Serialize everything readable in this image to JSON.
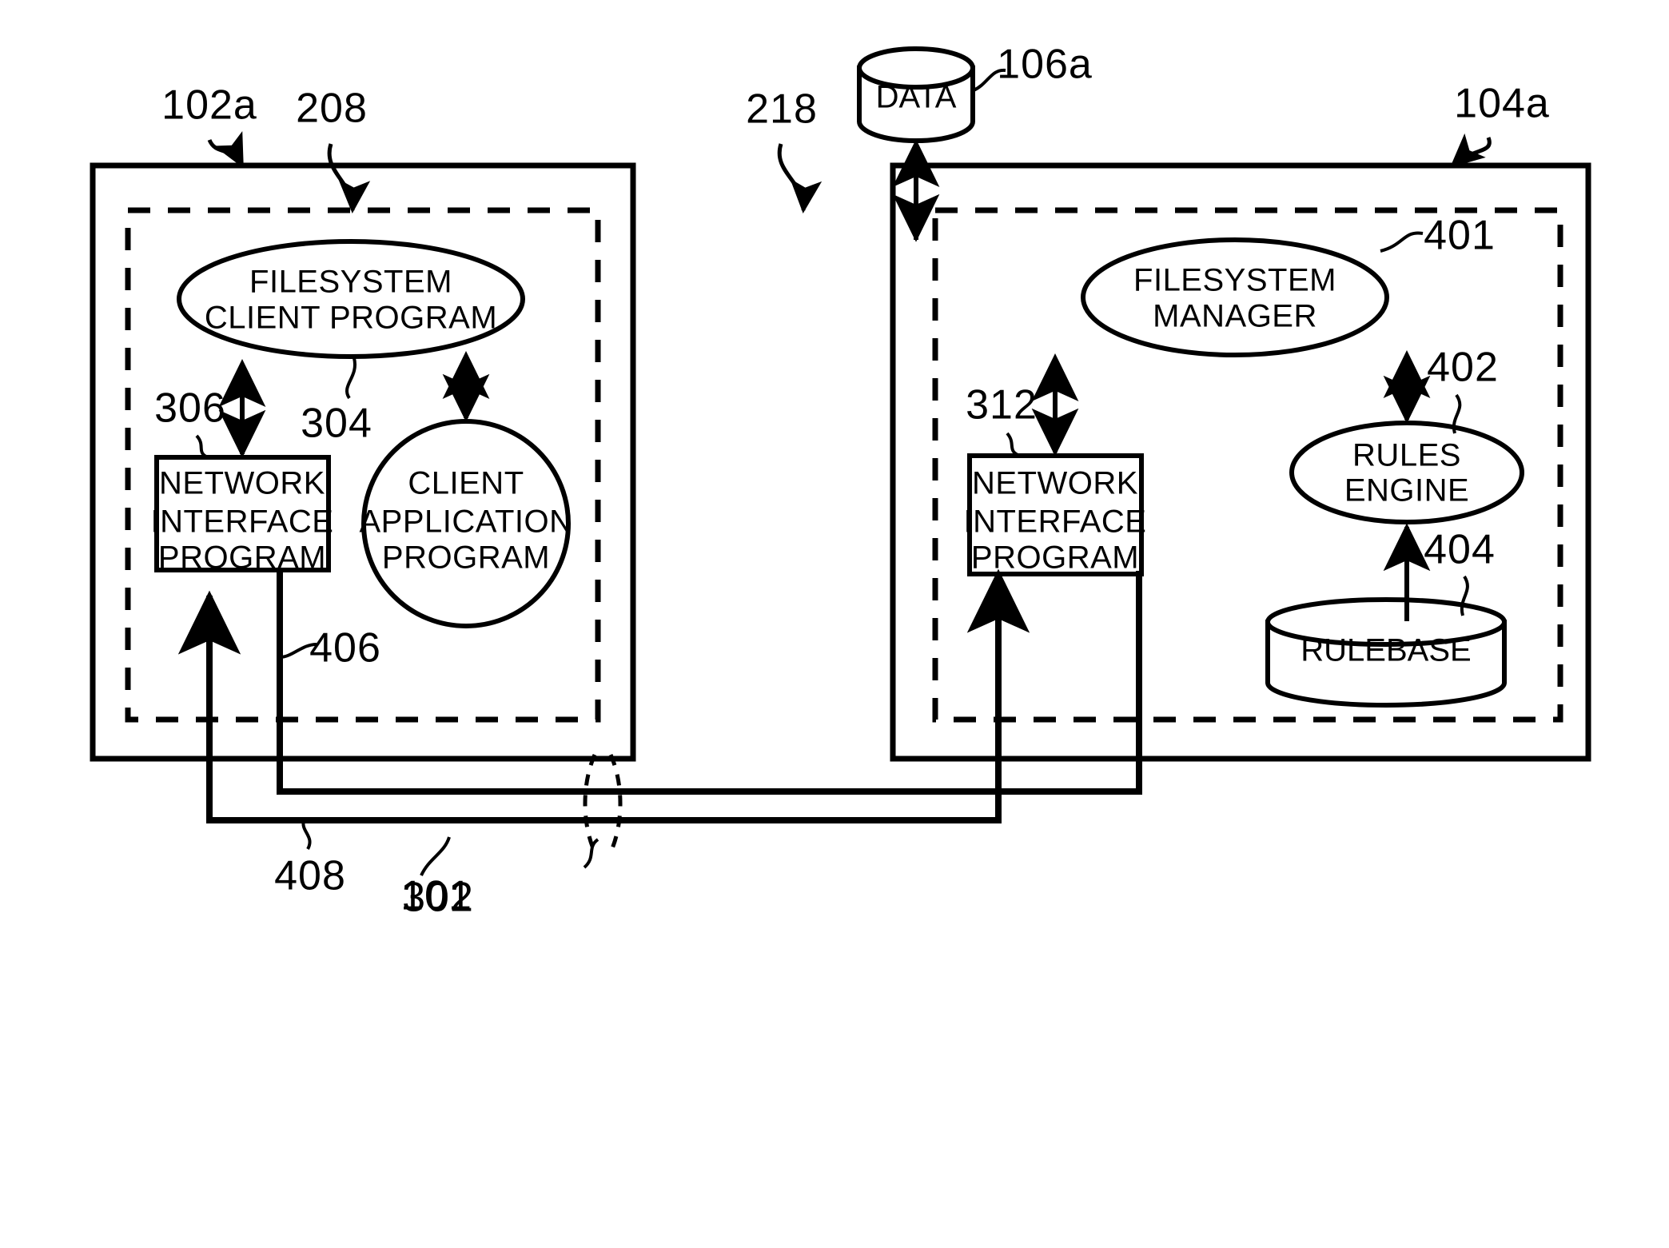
{
  "figure": {
    "type": "patent-block-diagram",
    "background": "#ffffff",
    "ink": "#000000"
  },
  "left_system": {
    "outer_ref": "102a",
    "inner_ref": "208",
    "nodes": {
      "filesystem_client_program": {
        "line1": "FILESYSTEM",
        "line2": "CLIENT PROGRAM",
        "ref": "304",
        "shape": "ellipse"
      },
      "network_interface_program": {
        "line1": "NETWORK",
        "line2": "INTERFACE",
        "line3": "PROGRAM",
        "ref": "306",
        "shape": "rectangle"
      },
      "client_application_program": {
        "line1": "CLIENT",
        "line2": "APPLICATION",
        "line3": "PROGRAM",
        "ref": "302",
        "shape": "circle"
      }
    },
    "link_ref": "406"
  },
  "right_system": {
    "outer_ref": "104a",
    "inner_ref": "218",
    "nodes": {
      "filesystem_manager": {
        "line1": "FILESYSTEM",
        "line2": "MANAGER",
        "ref": "401",
        "shape": "ellipse"
      },
      "network_interface_program": {
        "line1": "NETWORK",
        "line2": "INTERFACE",
        "line3": "PROGRAM",
        "ref": "312",
        "shape": "rectangle"
      },
      "rules_engine": {
        "line1": "RULES",
        "line2": "ENGINE",
        "ref": "402",
        "shape": "ellipse"
      },
      "rulebase": {
        "label": "RULEBASE",
        "ref": "404",
        "shape": "cylinder"
      }
    }
  },
  "data_store": {
    "label": "DATA",
    "ref": "106a",
    "shape": "cylinder"
  },
  "network": {
    "ref": "101",
    "link_ref": "408"
  },
  "reference_numbers": [
    "102a",
    "208",
    "218",
    "106a",
    "104a",
    "306",
    "304",
    "312",
    "401",
    "402",
    "404",
    "406",
    "302",
    "408",
    "101"
  ]
}
